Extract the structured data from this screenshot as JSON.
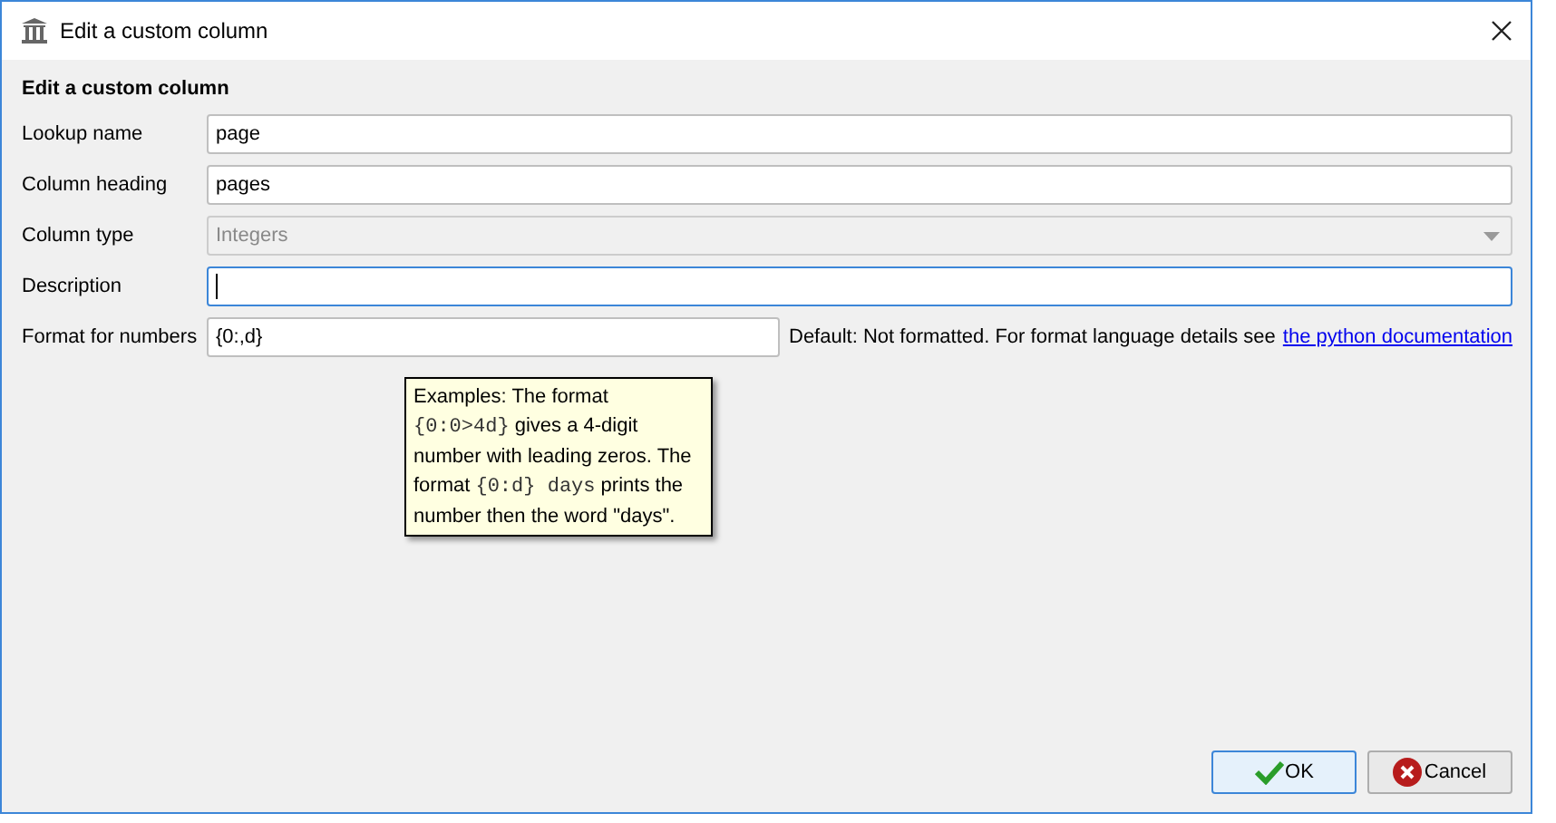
{
  "window": {
    "title": "Edit a custom column"
  },
  "heading": "Edit a custom column",
  "fields": [
    {
      "kind": "text",
      "label": "Lookup name",
      "value": "page",
      "disabled": false,
      "focused": false
    },
    {
      "kind": "text",
      "label": "Column heading",
      "value": "pages",
      "disabled": false,
      "focused": false
    },
    {
      "kind": "dropdown",
      "label": "Column type",
      "value": "Integers",
      "disabled": true,
      "focused": false
    },
    {
      "kind": "text",
      "label": "Description",
      "disabled": false,
      "focused": true
    },
    {
      "kind": "format",
      "label": "Format for numbers",
      "value": "{0:,d}",
      "disabled": false,
      "focused": false
    }
  ],
  "format_hint": {
    "text": "Default: Not formatted. For format language details see",
    "link": "the python documentation"
  },
  "tooltip": [
    {
      "kind": "plain",
      "text": "Examples: The format "
    },
    {
      "kind": "code",
      "text": "{0:0>4d}"
    },
    {
      "kind": "plain",
      "text": " gives a 4-digit number with leading zeros. The format "
    },
    {
      "kind": "code",
      "text": "{0:d} days"
    },
    {
      "kind": "plain",
      "text": " prints the number then the word \"days\"."
    }
  ],
  "buttons": [
    {
      "kind": "ok",
      "label": "OK",
      "default": true
    },
    {
      "kind": "cancel",
      "label": "Cancel",
      "default": false
    }
  ]
}
